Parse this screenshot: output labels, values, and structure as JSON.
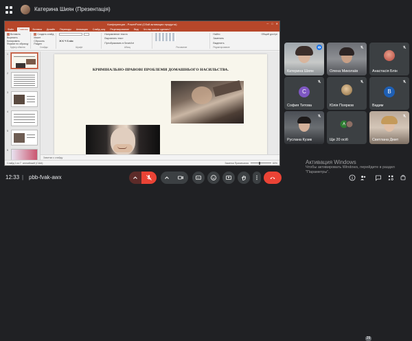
{
  "header": {
    "presenter_name": "Катерина Шиян (Презентація)"
  },
  "powerpoint": {
    "window_title": "Конференции - PowerPoint (Сбой активации продукта)",
    "tabs": [
      "Файл",
      "Главная",
      "Вставка",
      "Дизайн",
      "Переходы",
      "Анимация",
      "Слайд-шоу",
      "Рецензирование",
      "Вид",
      "Что вы хотите сделать?"
    ],
    "active_tab_index": 1,
    "ribbon": {
      "paste": "Вставить",
      "cut": "Вырезать",
      "copy": "Копировать",
      "format_painter": "Формат по образцу",
      "clipboard": "Буфер обмена",
      "new_slide": "Создать слайд",
      "layout": "Макет",
      "reset": "Сбросить",
      "section": "Раздел",
      "slides": "Слайды",
      "font": "Шрифт",
      "paragraph": "Абзац",
      "text_direction": "Направление текста",
      "align_text": "Выровнять текст",
      "smartart": "Преобразовать в SmartArt",
      "drawing": "Рисование",
      "find": "Найти",
      "replace": "Заменить",
      "select": "Выделить",
      "editing": "Редактирование",
      "share": "Общий доступ"
    },
    "slide_numbers": [
      "1",
      "2",
      "3",
      "4",
      "5",
      "6"
    ],
    "slide_title": "КРИМІНАЛЬНО-ПРАВОВІ ПРОБЛЕМИ ДОМАШНЬОГО НАСИЛЬСТВА.",
    "notes_placeholder": "Заметки к слайду",
    "status_left": "Слайд 1 из 7",
    "status_lang": "английский (США)",
    "status_right": "Заметки   Примечания",
    "zoom": "60%"
  },
  "participants": [
    {
      "name": "Катерина Шиян",
      "mic": "active",
      "type": "video"
    },
    {
      "name": "Олена Миколаїв",
      "mic": "muted",
      "type": "video"
    },
    {
      "name": "Анастасія Блін",
      "mic": "muted",
      "type": "avatar"
    },
    {
      "name": "София Титова",
      "mic": "muted",
      "type": "letter",
      "letter": "C",
      "color": "#7e57c2"
    },
    {
      "name": "Юлія Поярков",
      "mic": "muted",
      "type": "avatar"
    },
    {
      "name": "Вадим",
      "mic": "muted",
      "type": "letter",
      "letter": "B",
      "color": "#1e5fb4"
    },
    {
      "name": "Руслана Кузик",
      "mic": "muted",
      "type": "video"
    },
    {
      "name": "Ще 20 осіб",
      "mic": "none",
      "type": "more"
    },
    {
      "name": "Светлана Дмит",
      "mic": "muted",
      "type": "video"
    }
  ],
  "bottom": {
    "time": "12:33",
    "separator": "|",
    "meeting_code": "pbb-fvak-awx",
    "people_badge": "29"
  },
  "watermark": {
    "title": "Активация Windows",
    "line1": "Чтобы активировать Windows, перейдите в раздел",
    "line2": "\"Параметры\"."
  },
  "colors": {
    "meet_bg": "#202124",
    "tile_bg": "#3c4043",
    "ppt_accent": "#b7472a",
    "hangup_red": "#ea4335",
    "active_blue": "#1a73e8"
  }
}
